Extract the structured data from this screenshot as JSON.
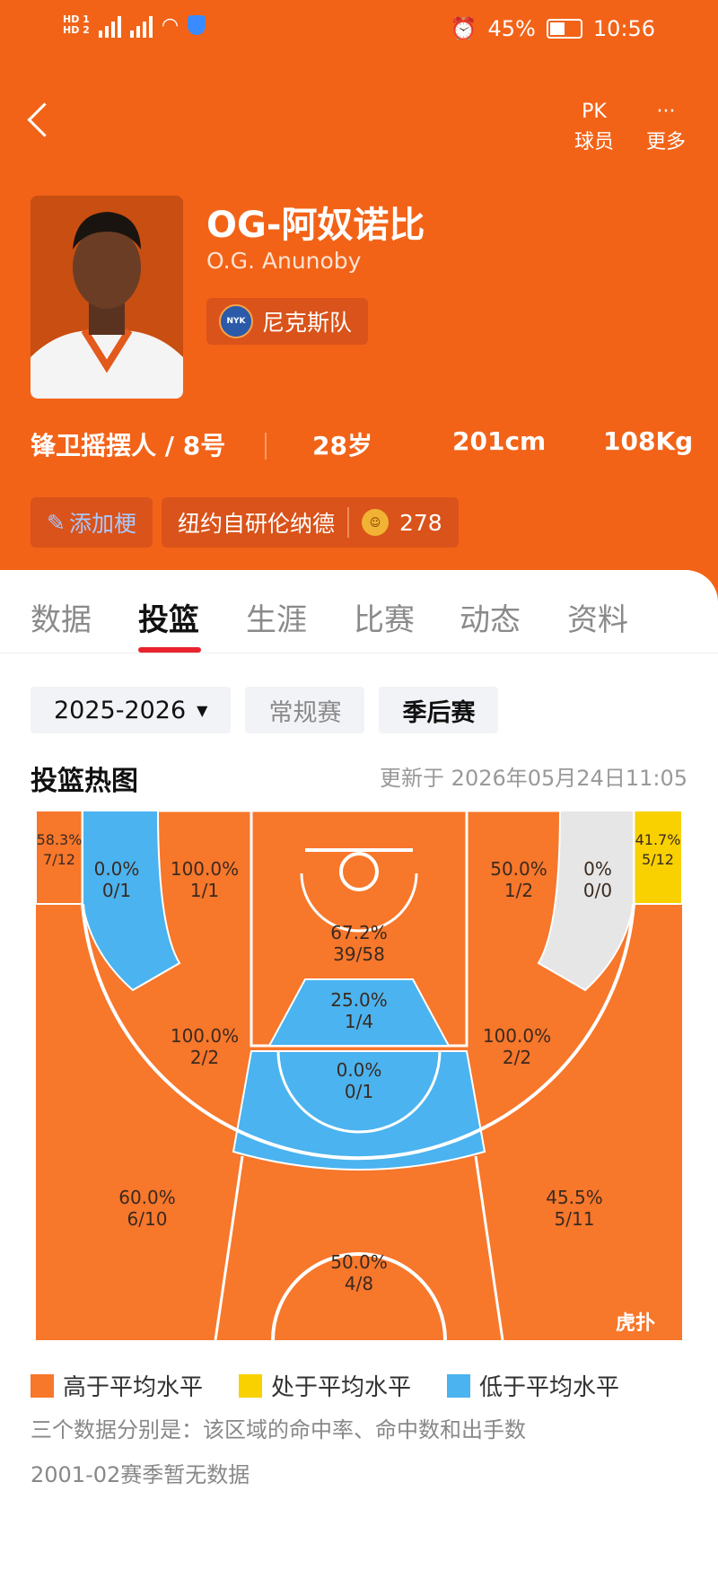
{
  "status_bar": {
    "left_icons": [
      "HD 1",
      "4G",
      "HD 2",
      "4G",
      "wifi-icon",
      "shield-icon"
    ],
    "battery": "45%",
    "time": "10:56"
  },
  "header": {
    "back_icon": "chevron-left-icon",
    "pk": {
      "icon": "PK",
      "label": "球员"
    },
    "more": {
      "icon": "···",
      "label": "更多"
    },
    "player_name": "OG-阿奴诺比",
    "player_name_en": "O.G. Anunoby",
    "team": "尼克斯队",
    "team_logo_text": "NYK",
    "position": "锋卫摇摆人 / 8号",
    "age": "28岁",
    "height": "201cm",
    "weight": "108Kg",
    "add_tag": "添加梗",
    "nickname_tag": "纽约自研伦纳德",
    "nickname_count": "278"
  },
  "tabs": [
    "数据",
    "投篮",
    "生涯",
    "比赛",
    "动态",
    "资料"
  ],
  "active_tab": "投篮",
  "filters": {
    "season": "2025-2026",
    "regular": "常规赛",
    "playoffs": "季后赛"
  },
  "section": {
    "title": "投篮热图",
    "updated": "更新于 2026年05月24日11:05"
  },
  "colors": {
    "above": "#f7772b",
    "avg": "#f9d100",
    "below": "#4bb3ef",
    "none": "#e6e6e6",
    "brand": "#f26318"
  },
  "zones": {
    "left_corner3": {
      "pct": "58.3%",
      "made": "7/12"
    },
    "left_baseline_mid": {
      "pct": "0.0%",
      "made": "0/1"
    },
    "left_short_mid": {
      "pct": "100.0%",
      "made": "1/1"
    },
    "paint": {
      "pct": "67.2%",
      "made": "39/58"
    },
    "right_short_mid": {
      "pct": "50.0%",
      "made": "1/2"
    },
    "right_baseline_mid": {
      "pct": "0%",
      "made": "0/0"
    },
    "right_corner3": {
      "pct": "41.7%",
      "made": "5/12"
    },
    "lane": {
      "pct": "25.0%",
      "made": "1/4"
    },
    "left_elbow": {
      "pct": "100.0%",
      "made": "2/2"
    },
    "right_elbow": {
      "pct": "100.0%",
      "made": "2/2"
    },
    "top_key": {
      "pct": "0.0%",
      "made": "0/1"
    },
    "left_wing3": {
      "pct": "60.0%",
      "made": "6/10"
    },
    "top3": {
      "pct": "50.0%",
      "made": "4/8"
    },
    "right_wing3": {
      "pct": "45.5%",
      "made": "5/11"
    }
  },
  "watermark": "虎扑",
  "legend": [
    "高于平均水平",
    "处于平均水平",
    "低于平均水平"
  ],
  "notes": [
    "三个数据分别是：该区域的命中率、命中数和出手数",
    "2001-02赛季暂无数据"
  ]
}
